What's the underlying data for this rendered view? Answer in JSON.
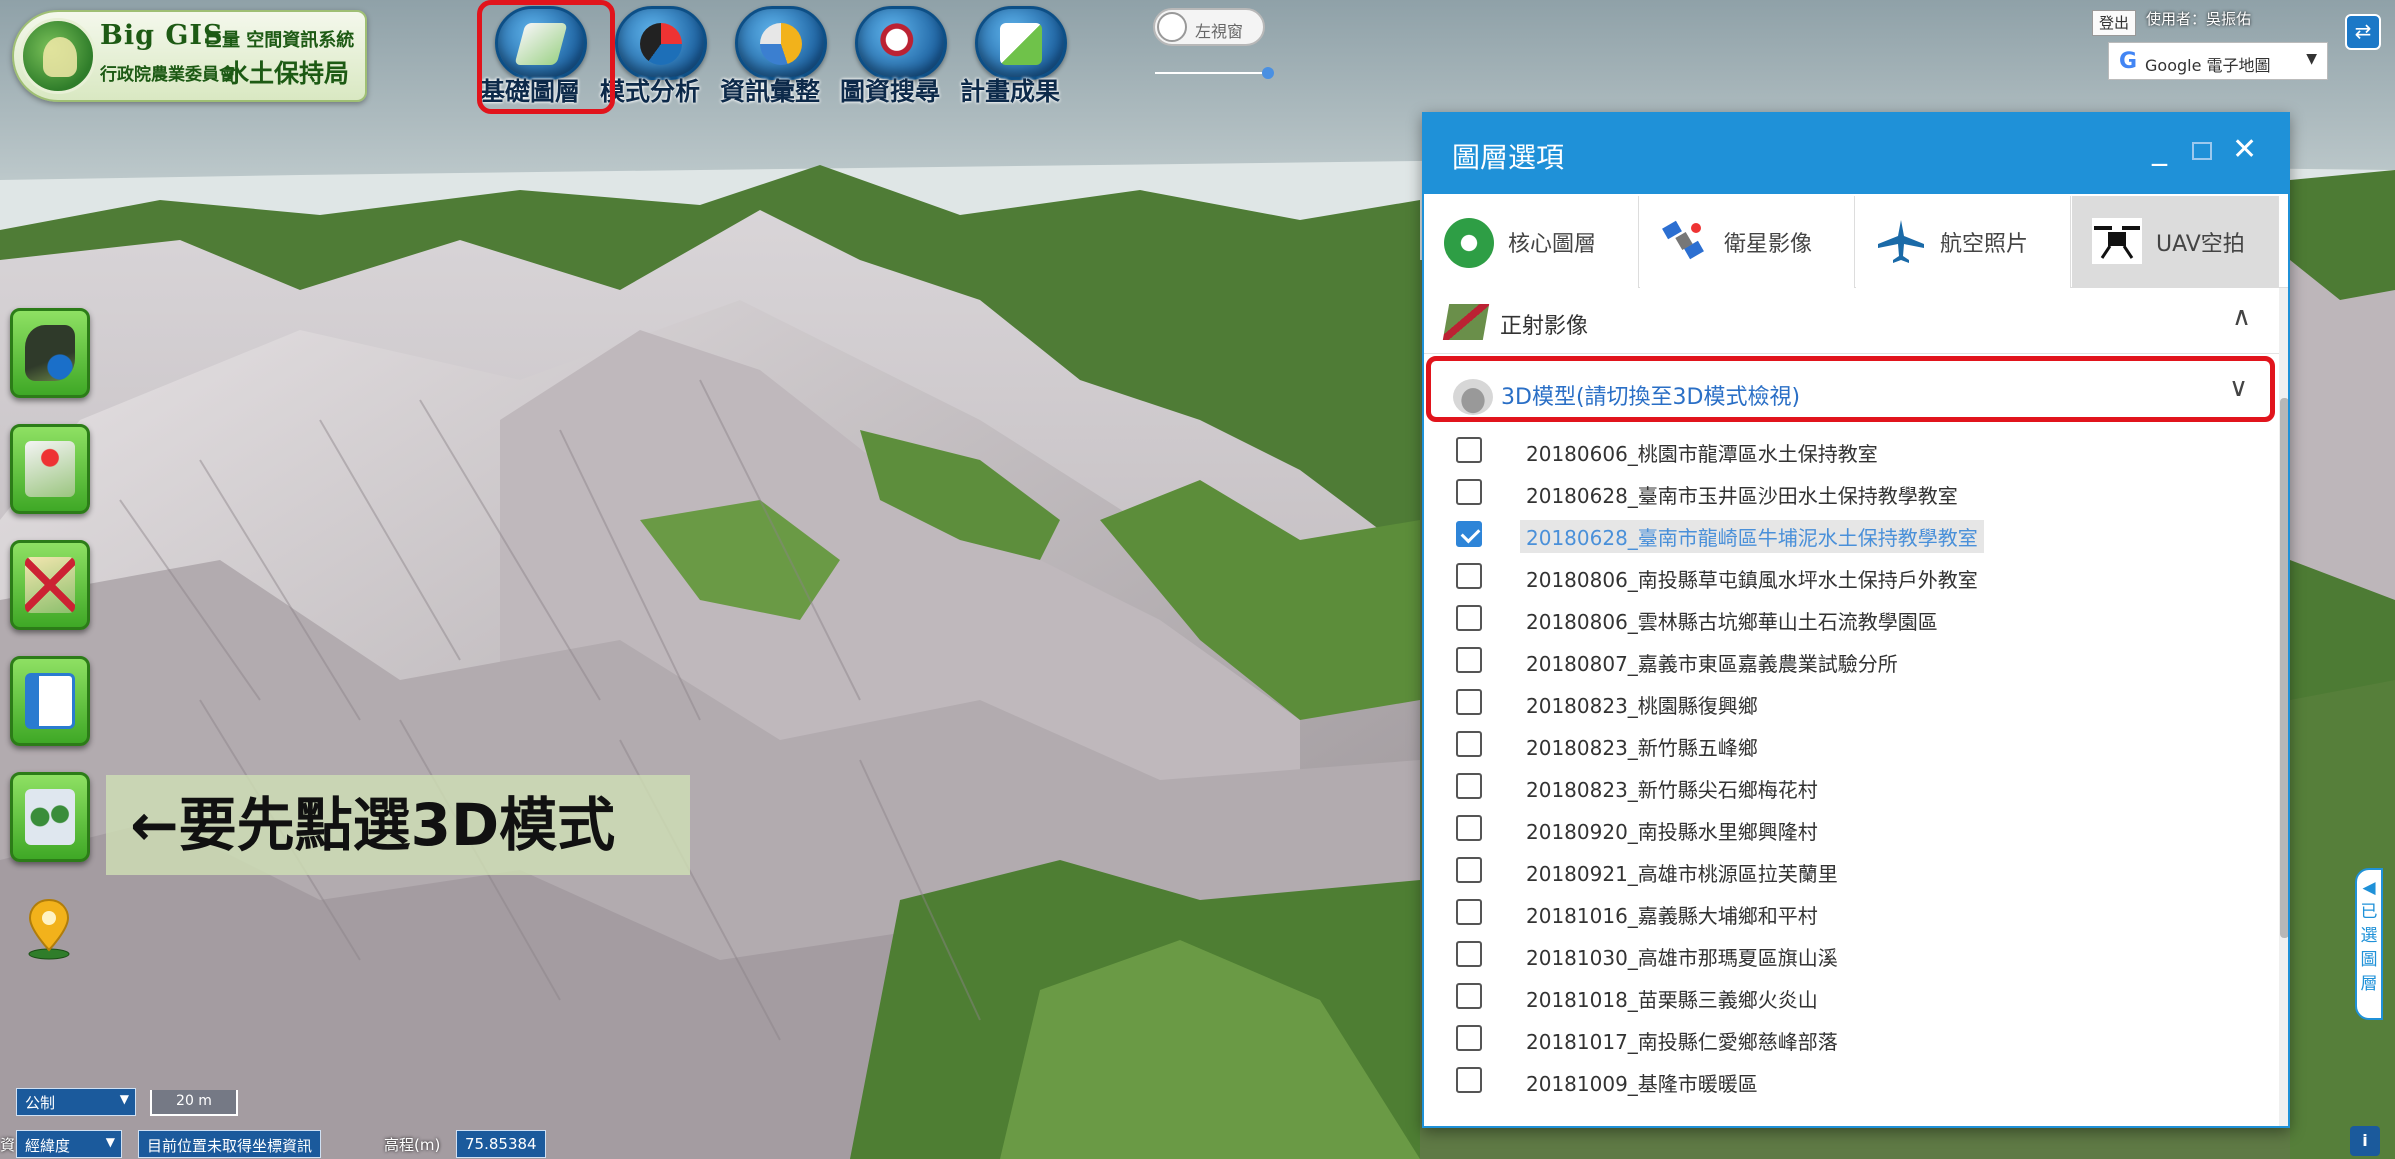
{
  "header": {
    "logo": {
      "brand": "Big GIS",
      "system": "巨量 空間資訊系統",
      "org": "行政院農業委員會",
      "bureau": "水土保持局"
    },
    "menu": [
      {
        "label": "基礎圖層",
        "icon": "base-layers-icon"
      },
      {
        "label": "模式分析",
        "icon": "analysis-icon"
      },
      {
        "label": "資訊彙整",
        "icon": "info-summary-icon"
      },
      {
        "label": "圖資搜尋",
        "icon": "map-search-icon"
      },
      {
        "label": "計畫成果",
        "icon": "project-results-icon"
      }
    ],
    "toggle_label": "左視窗",
    "logout_label": "登出",
    "user_label": "使用者：吳振佑",
    "basemap_select": "Google 電子地圖"
  },
  "hint_text": "←要先點選3D模式",
  "status": {
    "unit": "公制",
    "scale": "20 m",
    "coord_system": "經緯度",
    "coord_info": "目前位置未取得坐標資訊",
    "elevation_label": "高程(m)",
    "elevation_value": "75.85384",
    "left_partial": "資"
  },
  "panel": {
    "title": "圖層選項",
    "minimize": "_",
    "close": "✕",
    "tabs": [
      {
        "label": "核心圖層",
        "icon": "core-layers-icon"
      },
      {
        "label": "衛星影像",
        "icon": "satellite-icon"
      },
      {
        "label": "航空照片",
        "icon": "airplane-icon"
      },
      {
        "label": "UAV空拍",
        "icon": "drone-icon"
      }
    ],
    "sections": [
      {
        "label": "正射影像",
        "caret": "∧"
      },
      {
        "label": "3D模型(請切換至3D模式檢視)",
        "caret": "∨"
      }
    ],
    "items": [
      {
        "label": "20180606_桃園市龍潭區水土保持教室",
        "checked": false
      },
      {
        "label": "20180628_臺南市玉井區沙田水土保持教學教室",
        "checked": false
      },
      {
        "label": "20180628_臺南市龍崎區牛埔泥水土保持教學教室",
        "checked": true
      },
      {
        "label": "20180806_南投縣草屯鎮風水坪水土保持戶外教室",
        "checked": false
      },
      {
        "label": "20180806_雲林縣古坑鄉華山土石流教學園區",
        "checked": false
      },
      {
        "label": "20180807_嘉義市東區嘉義農業試驗分所",
        "checked": false
      },
      {
        "label": "20180823_桃園縣復興鄉",
        "checked": false
      },
      {
        "label": "20180823_新竹縣五峰鄉",
        "checked": false
      },
      {
        "label": "20180823_新竹縣尖石鄉梅花村",
        "checked": false
      },
      {
        "label": "20180920_南投縣水里鄉興隆村",
        "checked": false
      },
      {
        "label": "20180921_高雄市桃源區拉芙蘭里",
        "checked": false
      },
      {
        "label": "20181016_嘉義縣大埔鄉和平村",
        "checked": false
      },
      {
        "label": "20181030_高雄市那瑪夏區旗山溪",
        "checked": false
      },
      {
        "label": "20181018_苗栗縣三義鄉火炎山",
        "checked": false
      },
      {
        "label": "20181017_南投縣仁愛鄉慈峰部落",
        "checked": false
      },
      {
        "label": "20181009_基隆市暖暖區",
        "checked": false
      }
    ]
  },
  "side_tab": "◀ 已 選 圖 層",
  "colors": {
    "accent": "#1f91d8",
    "highlight": "#e1141c",
    "checked": "#2e85d8",
    "tool_green": "#3fa826"
  }
}
